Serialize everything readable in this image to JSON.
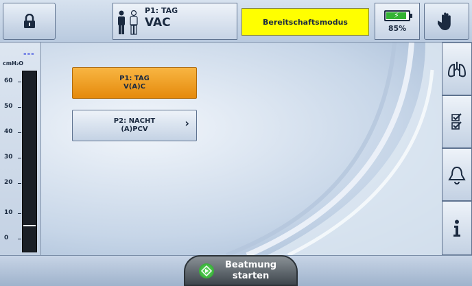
{
  "header": {
    "profile_line1": "P1: TAG",
    "profile_mode": "VAC",
    "status": "Bereitschaftsmodus",
    "battery_percent_text": "85%",
    "battery_level": 0.85,
    "status_color": "#ffff00"
  },
  "gauge": {
    "top_readout": "---",
    "unit": "cmH₂O",
    "ticks": [
      "60",
      "50",
      "40",
      "30",
      "20",
      "10",
      "0"
    ],
    "current_value": 5
  },
  "profiles": [
    {
      "line1": "P1: TAG",
      "line2": "V(A)C",
      "active": true
    },
    {
      "line1": "P2: NACHT",
      "line2": "(A)PCV",
      "active": false
    }
  ],
  "side_buttons": [
    "lungs-icon",
    "checklist-icon",
    "alarm-bell-icon",
    "info-icon"
  ],
  "bottom": {
    "start_line1": "Beatmung",
    "start_line2": "starten"
  },
  "colors": {
    "active_profile": "#f0a020",
    "start_icon": "#33b333"
  }
}
